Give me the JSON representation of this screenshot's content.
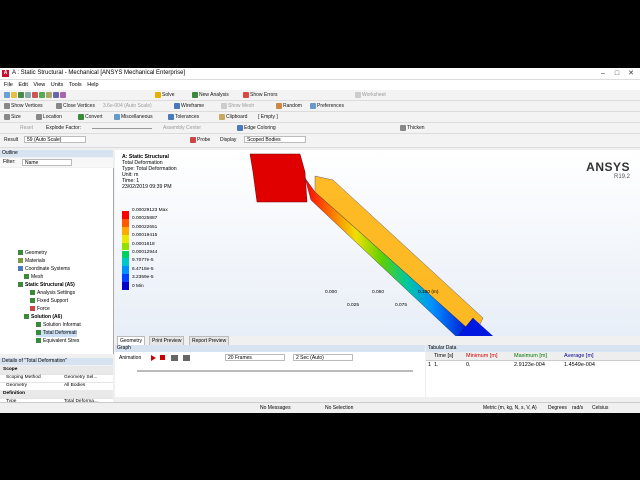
{
  "window": {
    "title": "A : Static Structural - Mechanical [ANSYS Mechanical Enterprise]"
  },
  "menu": [
    "File",
    "Edit",
    "View",
    "Units",
    "Tools",
    "Help"
  ],
  "toolbar1": {
    "solve": "Solve",
    "new_analysis": "New Analysis",
    "show_errors": "Show Errors",
    "worksheet": "Worksheet"
  },
  "toolbar2": {
    "show_vertices": "Show Vertices",
    "close_vertices": "Close Vertices",
    "auto_scale": "3.6e-004 (Auto Scale)",
    "wireframe": "Wireframe",
    "show_mesh": "Show Mesh",
    "random": "Random",
    "preferences": "Preferences"
  },
  "toolbar3": {
    "size": "Size",
    "location": "Location",
    "convert": "Convert",
    "misc": "Miscellaneous",
    "tolerances": "Tolerances",
    "clipboard": "Clipboard",
    "empty": "[ Empty ]"
  },
  "toolbar4": {
    "reset": "Reset",
    "explode": "Explode Factor:",
    "assembly_center": "Assembly Center",
    "edge_coloring": "Edge Coloring",
    "thicken": "Thicken"
  },
  "toolbar5": {
    "result": "Result",
    "result_scale": "59 (Auto Scale)",
    "probe": "Probe",
    "display": "Display",
    "scoped": "Scoped Bodies"
  },
  "outline": {
    "header": "Outline",
    "filter_label": "Filter:",
    "filter_value": "Name",
    "nodes": [
      "Geometry",
      "Materials",
      "Coordinate Systems",
      "Mesh",
      "Static Structural (A5)",
      "Analysis Settings",
      "Fixed Support",
      "Force",
      "Solution (A6)",
      "Solution Informat",
      "Total Deformati",
      "Equivalent Stres"
    ]
  },
  "details": {
    "header": "Details of \"Total Deformation\"",
    "rows": [
      {
        "k": "Scope",
        "v": "",
        "sec": true
      },
      {
        "k": "Scoping Method",
        "v": "Geometry Sel..."
      },
      {
        "k": "Geometry",
        "v": "All Bodies"
      },
      {
        "k": "Definition",
        "v": "",
        "sec": true
      },
      {
        "k": "Type",
        "v": "Total Deforma..."
      },
      {
        "k": "By",
        "v": "Time"
      },
      {
        "k": "Display Time",
        "v": "Last"
      },
      {
        "k": "Calculate Time History",
        "v": "Yes"
      },
      {
        "k": "Identifier",
        "v": ""
      },
      {
        "k": "Suppressed",
        "v": "No"
      },
      {
        "k": "Results",
        "v": "",
        "sec": true
      },
      {
        "k": "Minimum",
        "v": "0. m"
      }
    ]
  },
  "viewport": {
    "analysis": "A: Static Structural",
    "result": "Total Deformation",
    "type": "Type: Total Deformation",
    "unit": "Unit: m",
    "time": "Time: 1",
    "date": "23/02/2019 09:39 PM",
    "legend": [
      "0.00029123 Max",
      "0.00025887",
      "0.00022651",
      "0.00019415",
      "0.0001618",
      "0.00012944",
      "9.7077e-5",
      "6.4718e-5",
      "3.2359e-5",
      "0 Min"
    ],
    "legend_colors": [
      "#ff0000",
      "#ff5a00",
      "#ffaa00",
      "#e8e800",
      "#90e000",
      "#00d060",
      "#00c8c8",
      "#0090ff",
      "#0040ff",
      "#0000c8"
    ],
    "brand": "ANSYS",
    "version": "R19.2",
    "scale_top": [
      "0.000",
      "0.050",
      "0.100 (m)"
    ],
    "scale_bottom": [
      "0.025",
      "0.075"
    ]
  },
  "view_tabs": [
    "Geometry",
    "Print Preview",
    "Report Preview"
  ],
  "graph": {
    "header": "Graph",
    "animation": "Animation",
    "frames": "20 Frames",
    "duration": "2 Sec (Auto)"
  },
  "tabular": {
    "header": "Tabular Data",
    "cols": [
      "Time [s]",
      "Minimum [m]",
      "Maximum [m]",
      "Average [m]"
    ],
    "row": [
      "1",
      "1.",
      "0.",
      "2.9123e-004",
      "1.4549e-004"
    ]
  },
  "status": {
    "messages": "No Messages",
    "selection": "No Selection",
    "units": "Metric (m, kg, N, s, V, A)",
    "degrees": "Degrees",
    "rads": "rad/s",
    "temp": "Celsius"
  }
}
